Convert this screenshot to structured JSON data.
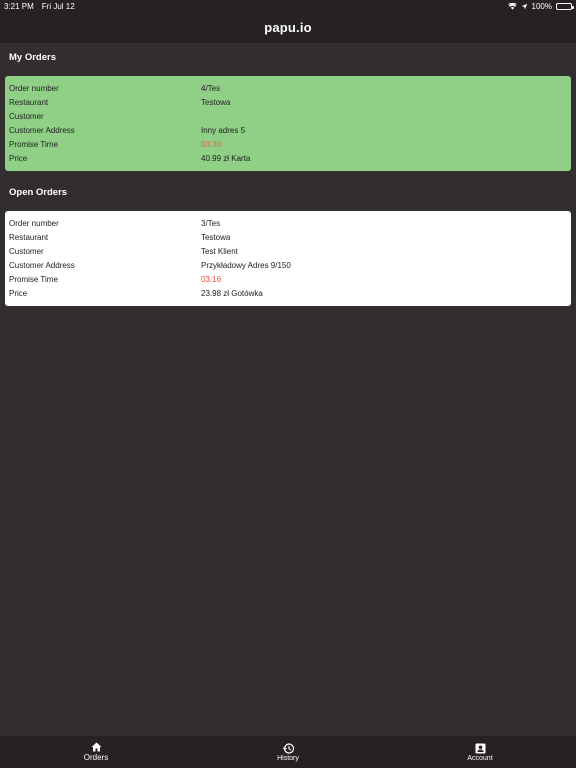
{
  "status_bar": {
    "time": "3:21 PM",
    "date": "Fri Jul 12",
    "battery": "100%"
  },
  "header": {
    "title": "papu.io"
  },
  "my_orders": {
    "title": "My Orders",
    "card_color": "#8fcf86",
    "rows": [
      {
        "label": "Order number",
        "value": "4/Tes"
      },
      {
        "label": "Restaurant",
        "value": "Testowa"
      },
      {
        "label": "Customer",
        "value": ""
      },
      {
        "label": "Customer Address",
        "value": "Inny adres 5"
      },
      {
        "label": "Promise Time",
        "value": "03:30"
      },
      {
        "label": "Price",
        "value": "40.99 zł Karta"
      }
    ]
  },
  "open_orders": {
    "title": "Open Orders",
    "card_color": "#ffffff",
    "rows": [
      {
        "label": "Order number",
        "value": "3/Tes"
      },
      {
        "label": "Restaurant",
        "value": "Testowa"
      },
      {
        "label": "Customer",
        "value": "Test Klient"
      },
      {
        "label": "Customer Address",
        "value": "Przykładowy Adres 9/150"
      },
      {
        "label": "Promise Time",
        "value": "03:16"
      },
      {
        "label": "Price",
        "value": "23.98 zł Gotówka"
      }
    ]
  },
  "tabs": [
    {
      "label": "Orders",
      "icon": "home-icon"
    },
    {
      "label": "History",
      "icon": "history-icon"
    },
    {
      "label": "Account",
      "icon": "account-icon"
    }
  ],
  "colors": {
    "background": "#322d2e",
    "bar": "#262223",
    "promise_time": "#e8473c"
  }
}
